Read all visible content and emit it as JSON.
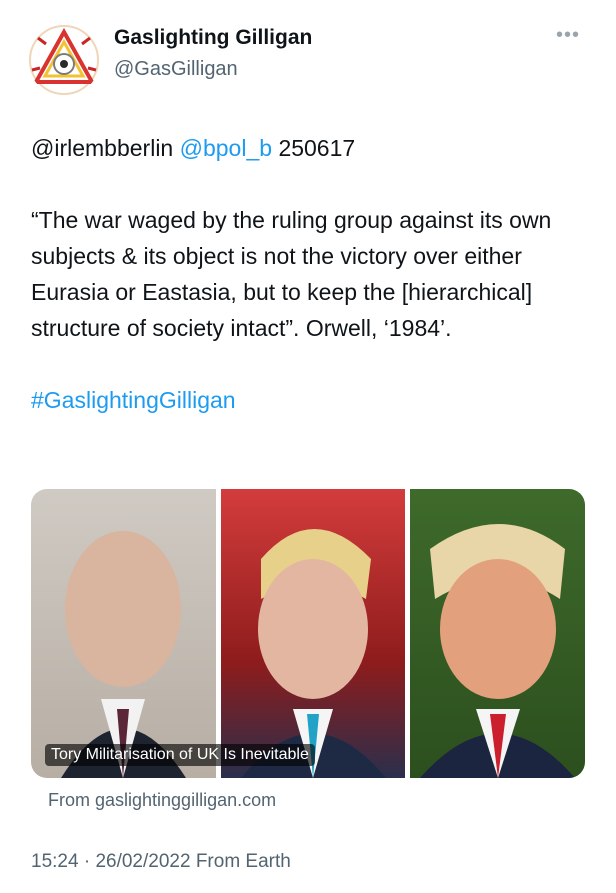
{
  "author": {
    "display_name": "Gaslighting Gilligan",
    "handle": "@GasGilligan",
    "avatar_icon": "triangle-eye-logo-icon"
  },
  "more_icon": "more-options-icon",
  "tweet": {
    "line1": {
      "mention1": "@irlembberlin",
      "mention2": "@bpol_b",
      "code": "250617"
    },
    "quote": "“The war waged by the ruling group against its own subjects & its object is not the victory over either Eurasia or Eastasia, but to keep the [hierarchical] structure of society intact”. Orwell, ‘1984’.",
    "hashtag": "#GaslightingGilligan"
  },
  "card": {
    "caption": "Tory Militarisation of UK Is Inevitable",
    "source": "From gaslightinggilligan.com"
  },
  "footer": {
    "time": "15:24",
    "separator": "·",
    "date": "26/02/2022",
    "location": "From Earth"
  },
  "colors": {
    "link": "#1d9bf0",
    "muted": "#536471",
    "text": "#0f1419"
  }
}
